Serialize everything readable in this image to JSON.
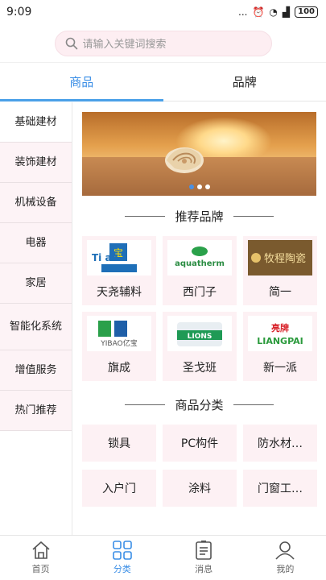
{
  "status_bar": {
    "time": "9:09",
    "signal_text": "...",
    "battery": "100"
  },
  "search": {
    "placeholder": "请输入关键词搜索"
  },
  "tabs": [
    {
      "label": "商品",
      "active": true
    },
    {
      "label": "品牌",
      "active": false
    }
  ],
  "sidebar": {
    "items": [
      {
        "label": "基础建材"
      },
      {
        "label": "装饰建材"
      },
      {
        "label": "机械设备"
      },
      {
        "label": "电器"
      },
      {
        "label": "家居"
      },
      {
        "label": "智能化系统"
      },
      {
        "label": "增值服务"
      },
      {
        "label": "热门推荐"
      }
    ]
  },
  "banner": {
    "dots": 3,
    "active_dot": 0
  },
  "brands_section": {
    "title": "推荐品牌",
    "brands": [
      {
        "name": "天尧辅料",
        "logo_text": "Ti  ao"
      },
      {
        "name": "西门子",
        "logo_text": "aquatherm"
      },
      {
        "name": "简一",
        "logo_text": "牧程陶瓷"
      },
      {
        "name": "旗成",
        "logo_text": "YIBAO亿宝"
      },
      {
        "name": "圣戈班",
        "logo_text": "LIONS"
      },
      {
        "name": "新一派",
        "logo_text": "亮牌 LIANGPAI"
      }
    ]
  },
  "category_section": {
    "title": "商品分类",
    "items": [
      "锁具",
      "PC构件",
      "防水材…",
      "入户门",
      "涂料",
      "门窗工…"
    ]
  },
  "bottom_nav": [
    {
      "label": "首页",
      "icon": "home-icon",
      "active": false
    },
    {
      "label": "分类",
      "icon": "grid-icon",
      "active": true
    },
    {
      "label": "消息",
      "icon": "message-icon",
      "active": false
    },
    {
      "label": "我的",
      "icon": "user-icon",
      "active": false
    }
  ],
  "colors": {
    "accent": "#3a8ee6",
    "pink_bg": "#fdf1f4"
  }
}
